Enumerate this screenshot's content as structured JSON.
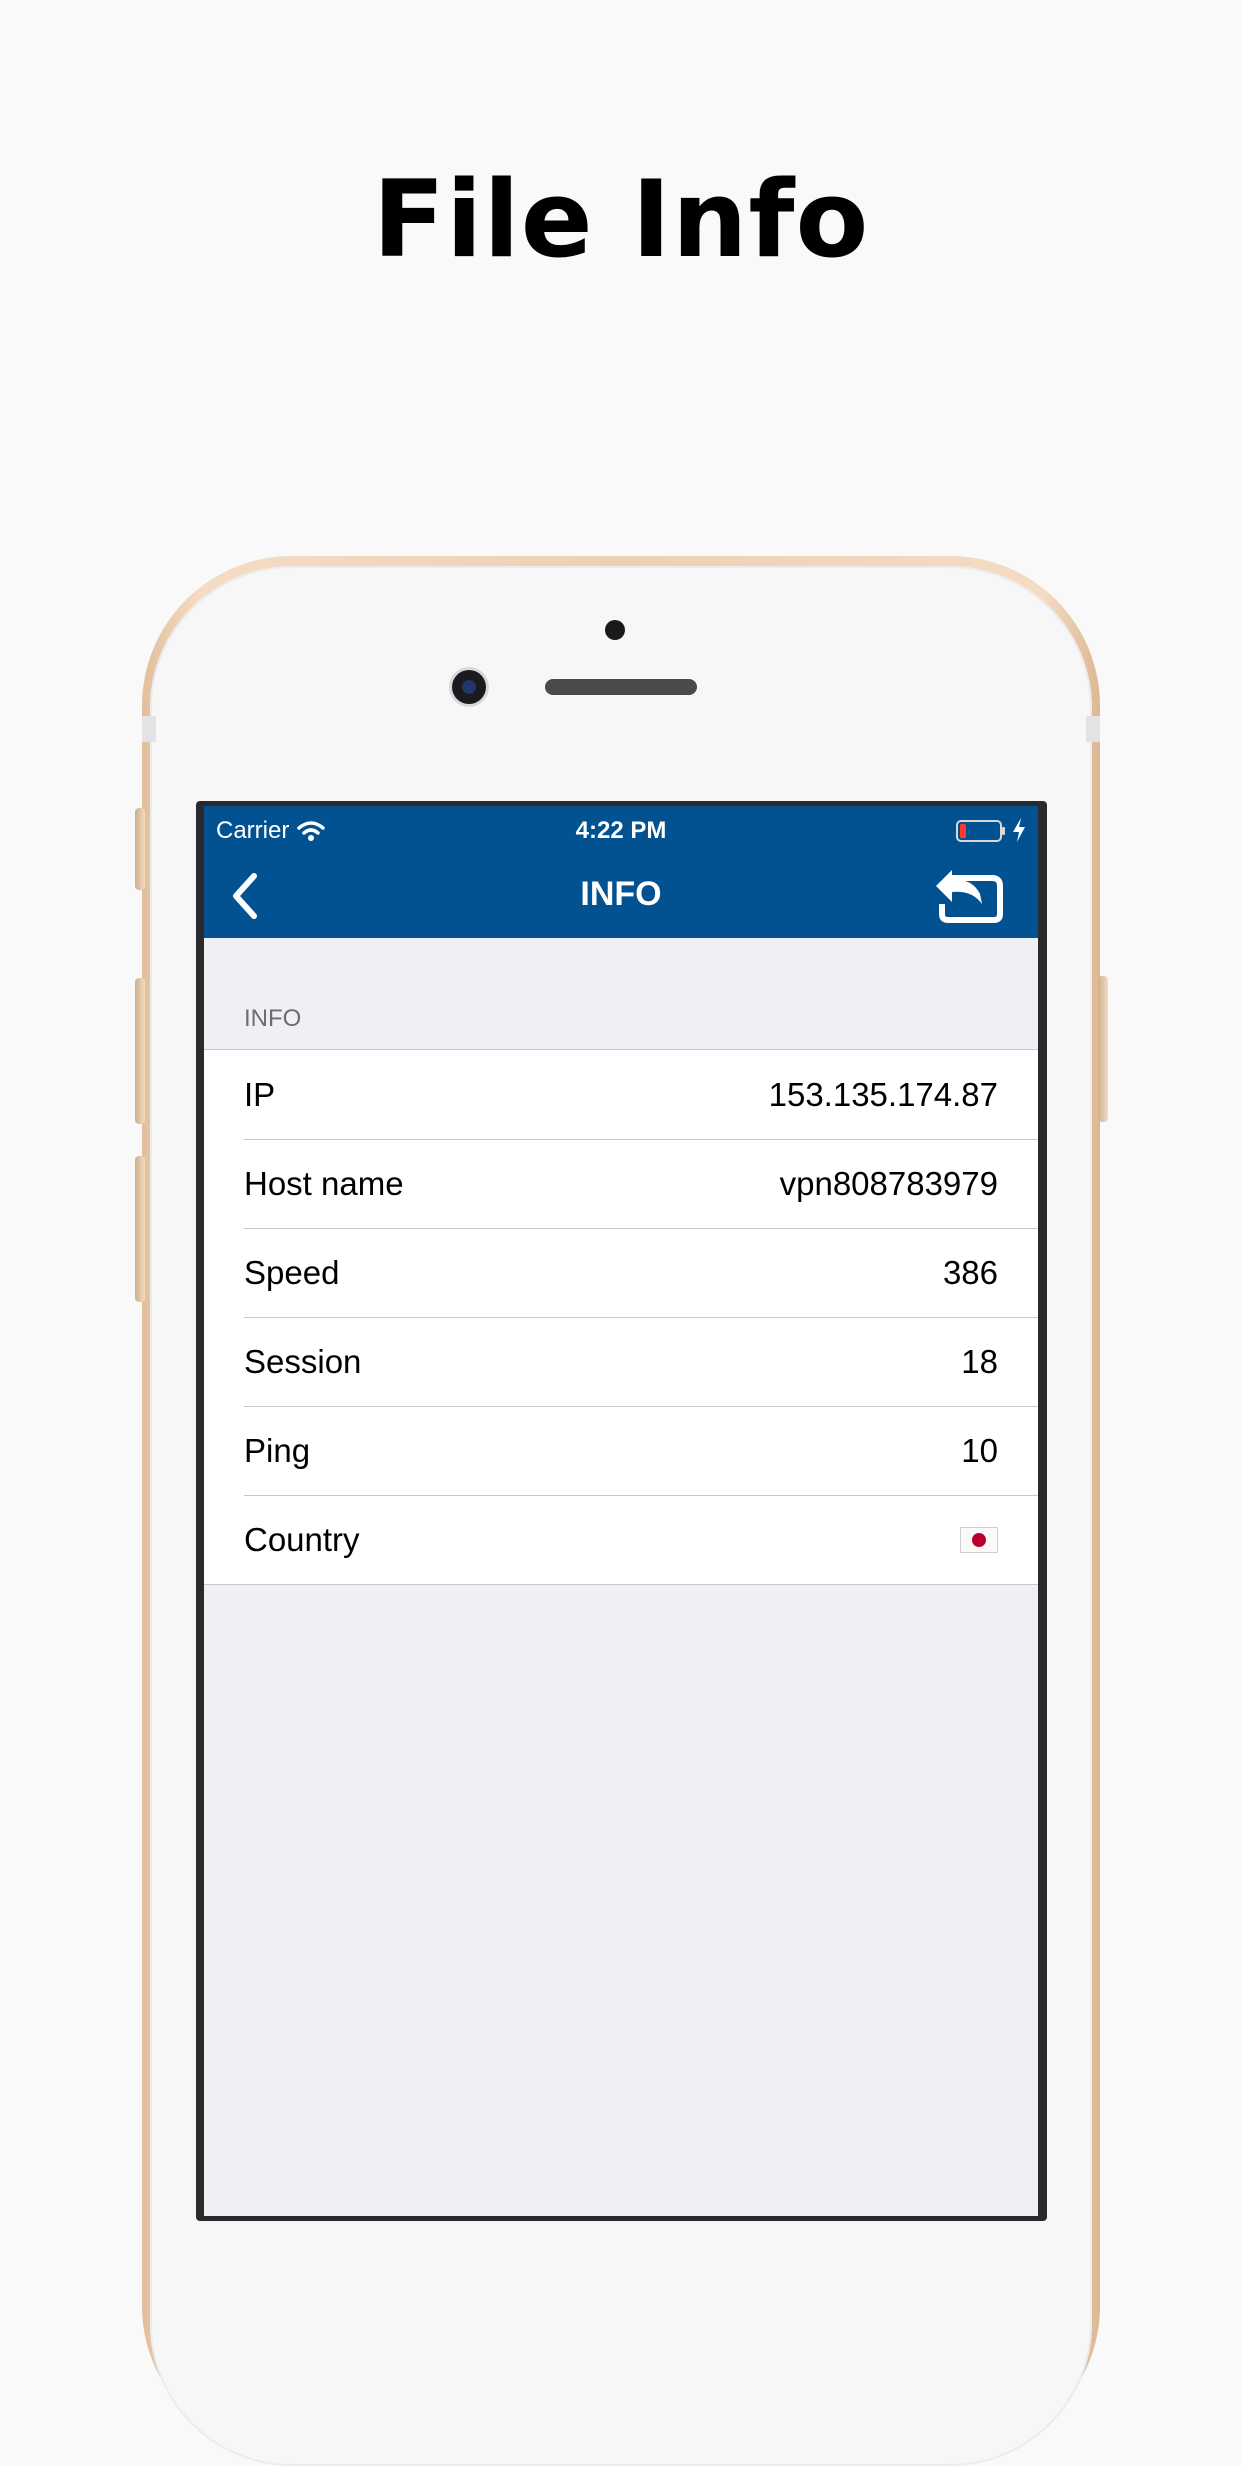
{
  "headline": "File Info",
  "status_bar": {
    "carrier": "Carrier",
    "time": "4:22 PM"
  },
  "navbar": {
    "title": "INFO",
    "back_icon": "chevron-left-icon",
    "action_icon": "share-reply-icon"
  },
  "section": {
    "header": "INFO"
  },
  "rows": [
    {
      "label": "IP",
      "value": "153.135.174.87"
    },
    {
      "label": "Host name",
      "value": "vpn808783979"
    },
    {
      "label": "Speed",
      "value": "386"
    },
    {
      "label": "Session",
      "value": "18"
    },
    {
      "label": "Ping",
      "value": "10"
    },
    {
      "label": "Country",
      "value": "",
      "flag": "japan-flag-icon"
    }
  ],
  "colors": {
    "navbar": "#025292",
    "background": "#efeff4",
    "phone_gold": "#ecd0b3"
  }
}
